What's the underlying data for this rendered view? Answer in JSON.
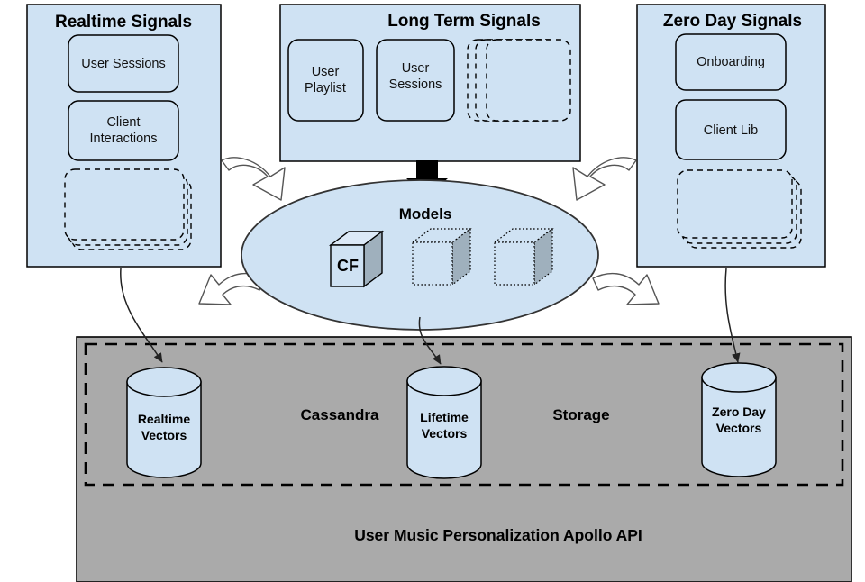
{
  "diagram": {
    "title_implicit": "User Music Personalization Architecture",
    "colors": {
      "panel_fill": "#cfe2f3",
      "panel_stroke": "#000000",
      "ellipse_fill": "#cfe2f3",
      "storage_fill": "#aaaaaa",
      "cube_front": "#cfe2f3",
      "cube_side": "#9fb0bd",
      "cube_top": "#dce9f7",
      "cylinder_fill": "#cfe2f3",
      "arrow_fill": "#ffffff",
      "arrow_stroke": "#444444",
      "black_arrow": "#000000"
    }
  },
  "panels": [
    {
      "id": "realtime-signals",
      "title": "Realtime Signals",
      "boxes": [
        {
          "label": "User Sessions",
          "style": "solid"
        },
        {
          "label": "Client Interactions",
          "lines": [
            "Client",
            "Interactions"
          ],
          "style": "solid"
        },
        {
          "label": "",
          "style": "dashed-stack",
          "stack_count": 3,
          "stack_direction": "vertical"
        }
      ]
    },
    {
      "id": "long-term-signals",
      "title": "Long Term Signals",
      "boxes": [
        {
          "label": "User Playlist",
          "lines": [
            "User",
            "Playlist"
          ],
          "style": "solid"
        },
        {
          "label": "User Sessions",
          "lines": [
            "User",
            "Sessions"
          ],
          "style": "solid"
        },
        {
          "label": "",
          "style": "dashed-stack",
          "stack_count": 3,
          "stack_direction": "horizontal"
        }
      ]
    },
    {
      "id": "zero-day-signals",
      "title": "Zero Day Signals",
      "boxes": [
        {
          "label": "Onboarding",
          "style": "solid"
        },
        {
          "label": "Client Lib",
          "style": "solid"
        },
        {
          "label": "",
          "style": "dashed-stack",
          "stack_count": 3,
          "stack_direction": "vertical"
        }
      ]
    }
  ],
  "models": {
    "title": "Models",
    "cubes": [
      {
        "label": "CF",
        "style": "solid"
      },
      {
        "label": "",
        "style": "dotted"
      },
      {
        "label": "",
        "style": "dotted"
      }
    ]
  },
  "storage": {
    "label_left": "Cassandra",
    "label_right": "Storage",
    "cylinders": [
      {
        "lines": [
          "Realtime",
          "Vectors"
        ],
        "label": "Realtime Vectors"
      },
      {
        "lines": [
          "Lifetime",
          "Vectors"
        ],
        "label": "Lifetime Vectors"
      },
      {
        "lines": [
          "Zero Day",
          "Vectors"
        ],
        "label": "Zero Day Vectors"
      }
    ]
  },
  "api_bar": {
    "label": "User Music Personalization Apollo API"
  }
}
